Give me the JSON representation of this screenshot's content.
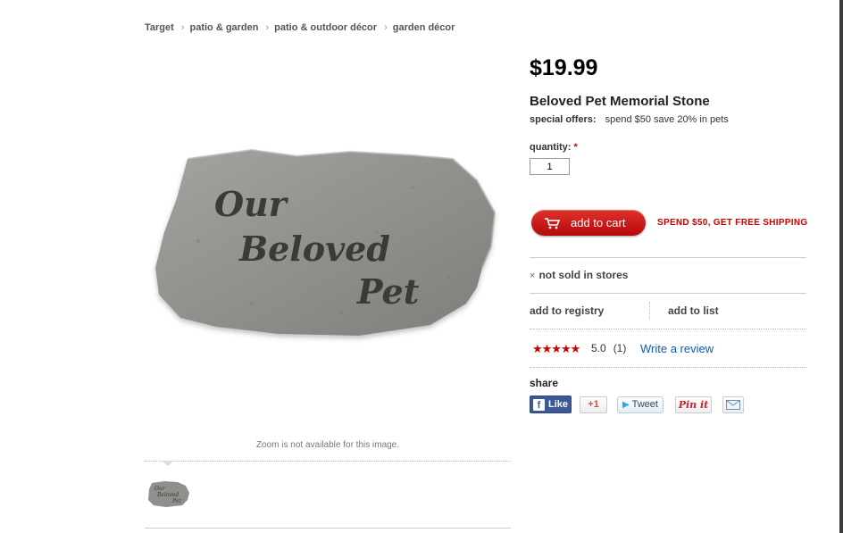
{
  "breadcrumb": {
    "items": [
      "Target",
      "patio & garden",
      "patio & outdoor décor",
      "garden décor"
    ],
    "separator": "›"
  },
  "product": {
    "price": "$19.99",
    "title": "Beloved Pet Memorial Stone",
    "special_offers_label": "special offers:",
    "special_offers_text": "spend $50 save 20% in pets",
    "image_engraving": [
      "Our",
      "Beloved",
      "Pet"
    ]
  },
  "gallery": {
    "zoom_note": "Zoom is not available for this image."
  },
  "purchase": {
    "quantity_label": "quantity:",
    "required_mark": "*",
    "quantity_value": "1",
    "add_to_cart_label": "add to cart",
    "free_shipping_text": "SPEND $50, GET FREE SHIPPING"
  },
  "availability": {
    "icon": "×",
    "text": "not sold in stores"
  },
  "actions": {
    "registry_label": "add to registry",
    "list_label": "add to list"
  },
  "reviews": {
    "stars": "★★★★★",
    "rating": "5.0",
    "count": "(1)",
    "write_review_label": "Write a review"
  },
  "share": {
    "label": "share",
    "facebook_label": "Like",
    "gplus_label": "+1",
    "tweet_label": "Tweet",
    "pinterest_label": "Pin it"
  },
  "colors": {
    "accent_red": "#cc0000",
    "link_blue": "#0a5ab4",
    "facebook_blue": "#3b5998"
  }
}
